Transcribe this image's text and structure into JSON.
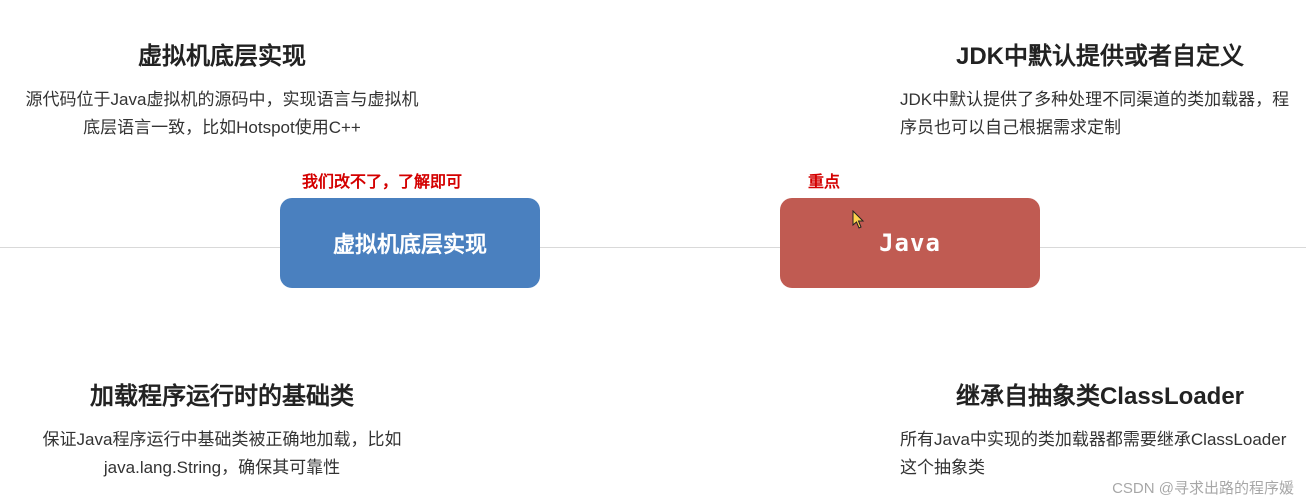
{
  "top_left": {
    "title": "虚拟机底层实现",
    "desc": "源代码位于Java虚拟机的源码中，实现语言与虚拟机底层语言一致，比如Hotspot使用C++"
  },
  "top_right": {
    "title": "JDK中默认提供或者自定义",
    "desc": "JDK中默认提供了多种处理不同渠道的类加载器，程序员也可以自己根据需求定制"
  },
  "bot_left": {
    "title": "加载程序运行时的基础类",
    "desc": "保证Java程序运行中基础类被正确地加载，比如java.lang.String，确保其可靠性"
  },
  "bot_right": {
    "title": "继承自抽象类ClassLoader",
    "desc": "所有Java中实现的类加载器都需要继承ClassLoader这个抽象类"
  },
  "pill_blue": "虚拟机底层实现",
  "pill_red": "Java",
  "anno_left": "我们改不了，了解即可",
  "anno_right": "重点",
  "watermark": "CSDN @寻求出路的程序媛"
}
